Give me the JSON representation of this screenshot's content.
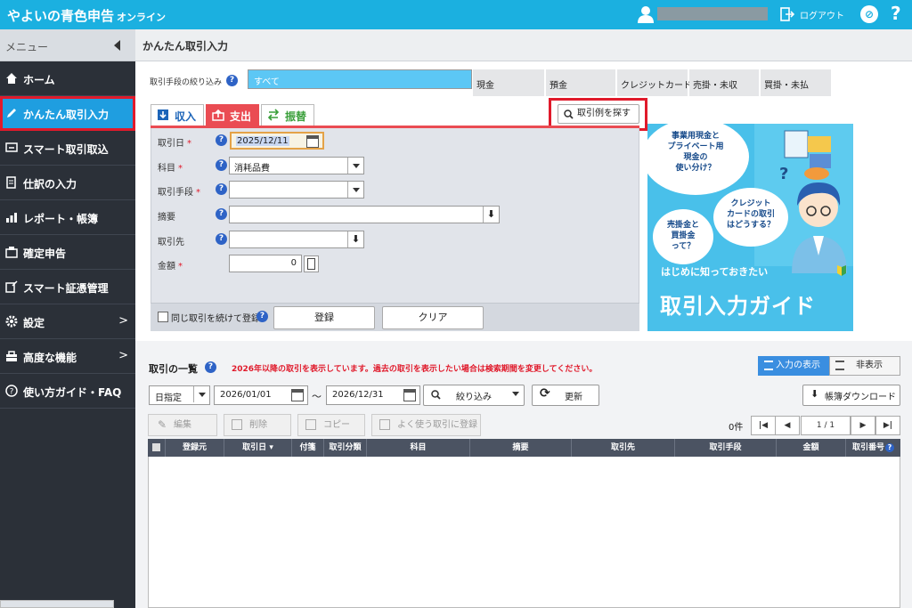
{
  "app": {
    "title": "やよいの青色申告",
    "subtitle": "オンライン"
  },
  "header": {
    "logout_label": "ログアウト",
    "help_label": "?"
  },
  "sidebar": {
    "menu_label": "メニュー",
    "items": [
      {
        "label": "ホーム",
        "icon": "home-icon"
      },
      {
        "label": "かんたん取引入力",
        "icon": "pencil-icon",
        "active": true
      },
      {
        "label": "スマート取引取込",
        "icon": "import-icon"
      },
      {
        "label": "仕訳の入力",
        "icon": "journal-icon"
      },
      {
        "label": "レポート・帳簿",
        "icon": "report-icon"
      },
      {
        "label": "確定申告",
        "icon": "tax-return-icon"
      },
      {
        "label": "スマート証憑管理",
        "icon": "document-icon"
      },
      {
        "label": "設定",
        "icon": "gear-icon"
      },
      {
        "label": "高度な機能",
        "icon": "toolbox-icon"
      },
      {
        "label": "使い方ガイド・FAQ",
        "icon": "help-icon"
      }
    ]
  },
  "page": {
    "title": "かんたん取引入力"
  },
  "filter": {
    "label": "取引手段の絞り込み",
    "tabs": [
      "すべて",
      "現金",
      "預金",
      "クレジットカード",
      "売掛・未収",
      "買掛・未払"
    ],
    "selected": "すべて"
  },
  "entry": {
    "tabs": {
      "income": "収入",
      "expense": "支出",
      "transfer": "振替"
    },
    "search_example": "取引例を探す",
    "fields": {
      "date_label": "取引日",
      "date_value": "2025/12/11",
      "account_label": "科目",
      "account_value": "消耗品費",
      "method_label": "取引手段",
      "method_value": "",
      "memo_label": "摘要",
      "memo_value": "",
      "partner_label": "取引先",
      "partner_value": "",
      "amount_label": "金額",
      "amount_value": "0"
    },
    "required_mark": "*",
    "repeat_label": "同じ取引を続けて登録",
    "register_button": "登録",
    "clear_button": "クリア"
  },
  "banner": {
    "bubble1": "事業用現金と\nプライベート用\n現金の\n使い分け？",
    "bubble2": "クレジット\nカードの取引\nはどうする？",
    "bubble3": "売掛金と\n買掛金\nって？",
    "subtitle": "はじめに知っておきたい",
    "title": "取引入力ガイド",
    "bg_color": "#49c0ea"
  },
  "list": {
    "title": "取引の一覧",
    "notice": "2026年以降の取引を表示しています。過去の取引を表示したい場合は検索期間を変更してください。",
    "show_input": "入力の表示",
    "hide_input": "非表示",
    "date_mode": "日指定",
    "date_from": "2026/01/01",
    "date_sep": "～",
    "date_to": "2026/12/31",
    "narrow": "絞り込み",
    "refresh": "更新",
    "download": "帳簿ダウンロード",
    "toolbar": {
      "edit": "編集",
      "delete": "削除",
      "copy": "コピー",
      "register_favorite": "よく使う取引に登録"
    },
    "count": "0件",
    "page_current": "1",
    "page_sep": "/",
    "page_total": "1",
    "columns": [
      "登録元",
      "取引日",
      "付箋",
      "取引分類",
      "科目",
      "摘要",
      "取引先",
      "取引手段",
      "金額",
      "取引番号"
    ]
  },
  "colors": {
    "brand": "#1bb0e0",
    "sidebar": "#2b3038",
    "active": "#1f9ee0",
    "highlight": "#e01a2b",
    "expense": "#ea4c53"
  }
}
